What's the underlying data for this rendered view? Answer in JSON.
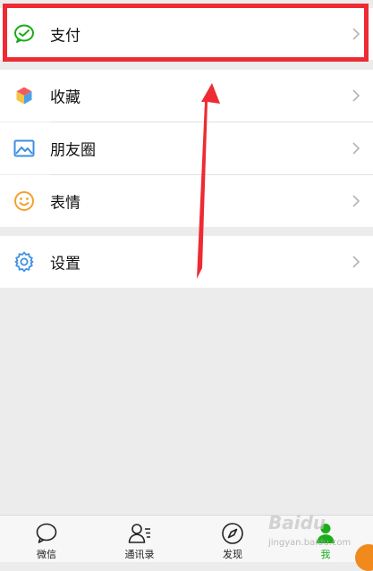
{
  "menu": {
    "pay": "支付",
    "favorites": "收藏",
    "moments": "朋友圈",
    "stickers": "表情",
    "settings": "设置"
  },
  "tabs": [
    {
      "label": "微信"
    },
    {
      "label": "通讯录"
    },
    {
      "label": "发现"
    },
    {
      "label": "我"
    }
  ],
  "watermark": {
    "text": "Baidu",
    "sub": "jingyan.baidu.com"
  },
  "colors": {
    "highlight": "#ee2b33",
    "accent_green": "#1aad19",
    "settings_blue": "#3f8fe0",
    "sticker_orange": "#f2a230"
  }
}
